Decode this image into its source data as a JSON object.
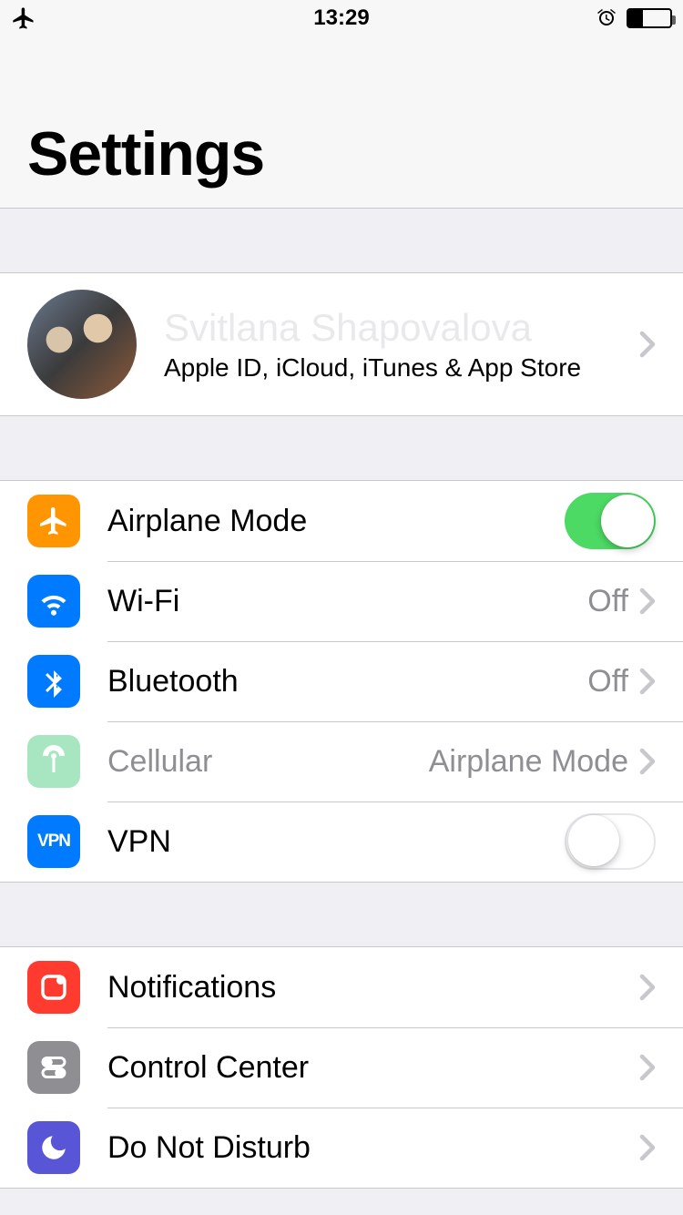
{
  "status_bar": {
    "time": "13:29"
  },
  "header": {
    "title": "Settings"
  },
  "profile": {
    "name": "Svitlana Shapovalova",
    "subtitle": "Apple ID, iCloud, iTunes & App Store"
  },
  "connectivity": {
    "airplane": {
      "label": "Airplane Mode",
      "on": true
    },
    "wifi": {
      "label": "Wi-Fi",
      "value": "Off"
    },
    "bluetooth": {
      "label": "Bluetooth",
      "value": "Off"
    },
    "cellular": {
      "label": "Cellular",
      "value": "Airplane Mode",
      "disabled": true
    },
    "vpn": {
      "label": "VPN",
      "icon_text": "VPN",
      "on": false
    }
  },
  "system": {
    "notifications": {
      "label": "Notifications"
    },
    "control_center": {
      "label": "Control Center"
    },
    "dnd": {
      "label": "Do Not Disturb"
    }
  }
}
